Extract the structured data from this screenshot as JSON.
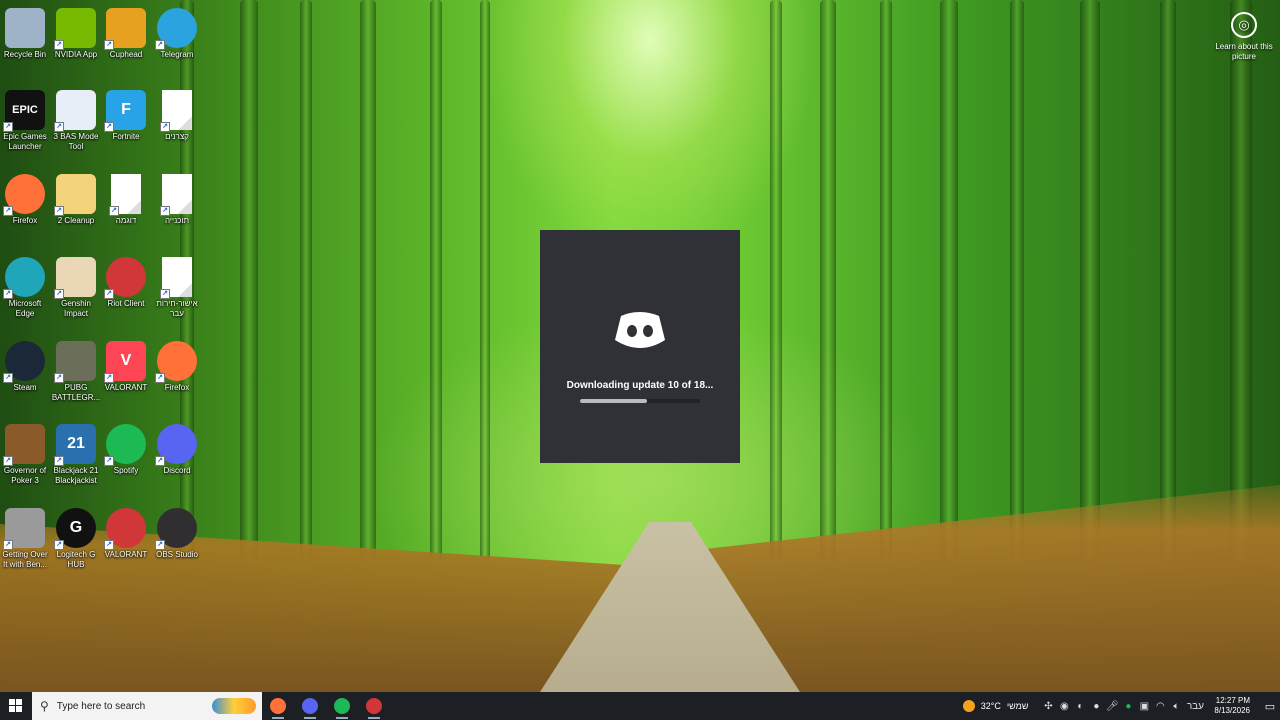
{
  "desktop_icons": [
    {
      "label": "Recycle Bin",
      "icon": "recycle-bin-icon",
      "color": "#9fb3c8"
    },
    {
      "label": "NVIDIA App",
      "icon": "nvidia-icon",
      "color": "#76b900"
    },
    {
      "label": "Cuphead",
      "icon": "cuphead-icon",
      "color": "#e8a020"
    },
    {
      "label": "Telegram",
      "icon": "telegram-icon",
      "color": "#2aa3df"
    },
    {
      "label": "Epic Games Launcher",
      "icon": "epic-games-icon",
      "color": "#111111",
      "glyph": "EPIC"
    },
    {
      "label": "3 BAS Mode Tool",
      "icon": "tool-icon",
      "color": "#e7eef7"
    },
    {
      "label": "Fortnite",
      "icon": "fortnite-icon",
      "color": "#29a3e8",
      "glyph": "F"
    },
    {
      "label": "קצרנים",
      "icon": "document-icon",
      "color": "#ffffff"
    },
    {
      "label": "Firefox",
      "icon": "firefox-icon",
      "color": "#ff7139"
    },
    {
      "label": "2 Cleanup",
      "icon": "folder-icon",
      "color": "#f3d27a"
    },
    {
      "label": "דוגמה",
      "icon": "document-icon",
      "color": "#ffffff"
    },
    {
      "label": "תוכנייה",
      "icon": "document-icon",
      "color": "#ffffff"
    },
    {
      "label": "Microsoft Edge",
      "icon": "edge-icon",
      "color": "#1fa6b8"
    },
    {
      "label": "Genshin Impact",
      "icon": "genshin-icon",
      "color": "#e9d7b5"
    },
    {
      "label": "Riot Client",
      "icon": "riot-icon",
      "color": "#d13639"
    },
    {
      "label": "אישור-חירות עבר",
      "icon": "document-icon",
      "color": "#ffffff"
    },
    {
      "label": "Steam",
      "icon": "steam-icon",
      "color": "#1b2838"
    },
    {
      "label": "PUBG BATTLEGR...",
      "icon": "pubg-icon",
      "color": "#6b6f5a"
    },
    {
      "label": "VALORANT",
      "icon": "valorant-icon",
      "color": "#fd4556",
      "glyph": "V"
    },
    {
      "label": "Firefox",
      "icon": "firefox-icon",
      "color": "#ff7139"
    },
    {
      "label": "Governor of Poker 3",
      "icon": "governor-poker-icon",
      "color": "#8a5a2b"
    },
    {
      "label": "Blackjack 21 Blackjackist",
      "icon": "blackjack-icon",
      "color": "#2a6fae",
      "glyph": "21"
    },
    {
      "label": "Spotify",
      "icon": "spotify-icon",
      "color": "#1db954"
    },
    {
      "label": "Discord",
      "icon": "discord-icon",
      "color": "#5865f2"
    },
    {
      "label": "Getting Over It with Ben...",
      "icon": "hammer-icon",
      "color": "#9a9a9a"
    },
    {
      "label": "Logitech G HUB",
      "icon": "logitech-icon",
      "color": "#111111",
      "glyph": "G"
    },
    {
      "label": "VALORANT",
      "icon": "riot-icon",
      "color": "#d13639"
    },
    {
      "label": "OBS Studio",
      "icon": "obs-icon",
      "color": "#302e31"
    }
  ],
  "learn_picture": {
    "label": "Learn about this picture"
  },
  "updater": {
    "status": "Downloading update 10 of 18...",
    "progress": 0.56,
    "accent": "#2f3136"
  },
  "taskbar": {
    "search_placeholder": "Type here to search",
    "apps": [
      {
        "name": "firefox",
        "color": "#ff7139"
      },
      {
        "name": "discord",
        "color": "#5865f2"
      },
      {
        "name": "spotify",
        "color": "#1db954"
      },
      {
        "name": "obs",
        "color": "#d13639"
      }
    ],
    "weather": {
      "temp": "32°C",
      "desc": "שמשי"
    },
    "language": "עבר",
    "time": "12:27 PM",
    "date": "8/13/2026"
  }
}
